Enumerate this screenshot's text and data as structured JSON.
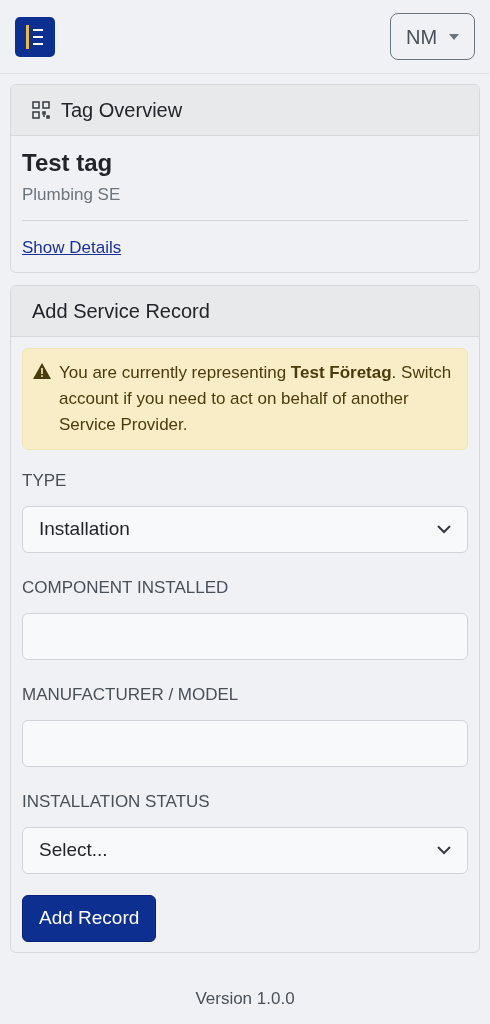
{
  "header": {
    "user_menu": "NM"
  },
  "tag_overview": {
    "title": "Tag Overview",
    "tag_name": "Test tag",
    "subtitle": "Plumbing SE",
    "link": "Show Details"
  },
  "service_record": {
    "title": "Add Service Record",
    "alert": "You are currently representing **Test Företag**. Switch account if you need to act on behalf of another Service Provider.",
    "fields": [
      {
        "kind": "select",
        "label": "TYPE",
        "value": "Installation"
      },
      {
        "kind": "text",
        "label": "COMPONENT INSTALLED"
      },
      {
        "kind": "text",
        "label": "MANUFACTURER / MODEL"
      },
      {
        "kind": "select",
        "label": "INSTALLATION STATUS",
        "value": "Select..."
      }
    ],
    "submit": "Add Record"
  },
  "footer": {
    "version": "Version 1.0.0"
  }
}
